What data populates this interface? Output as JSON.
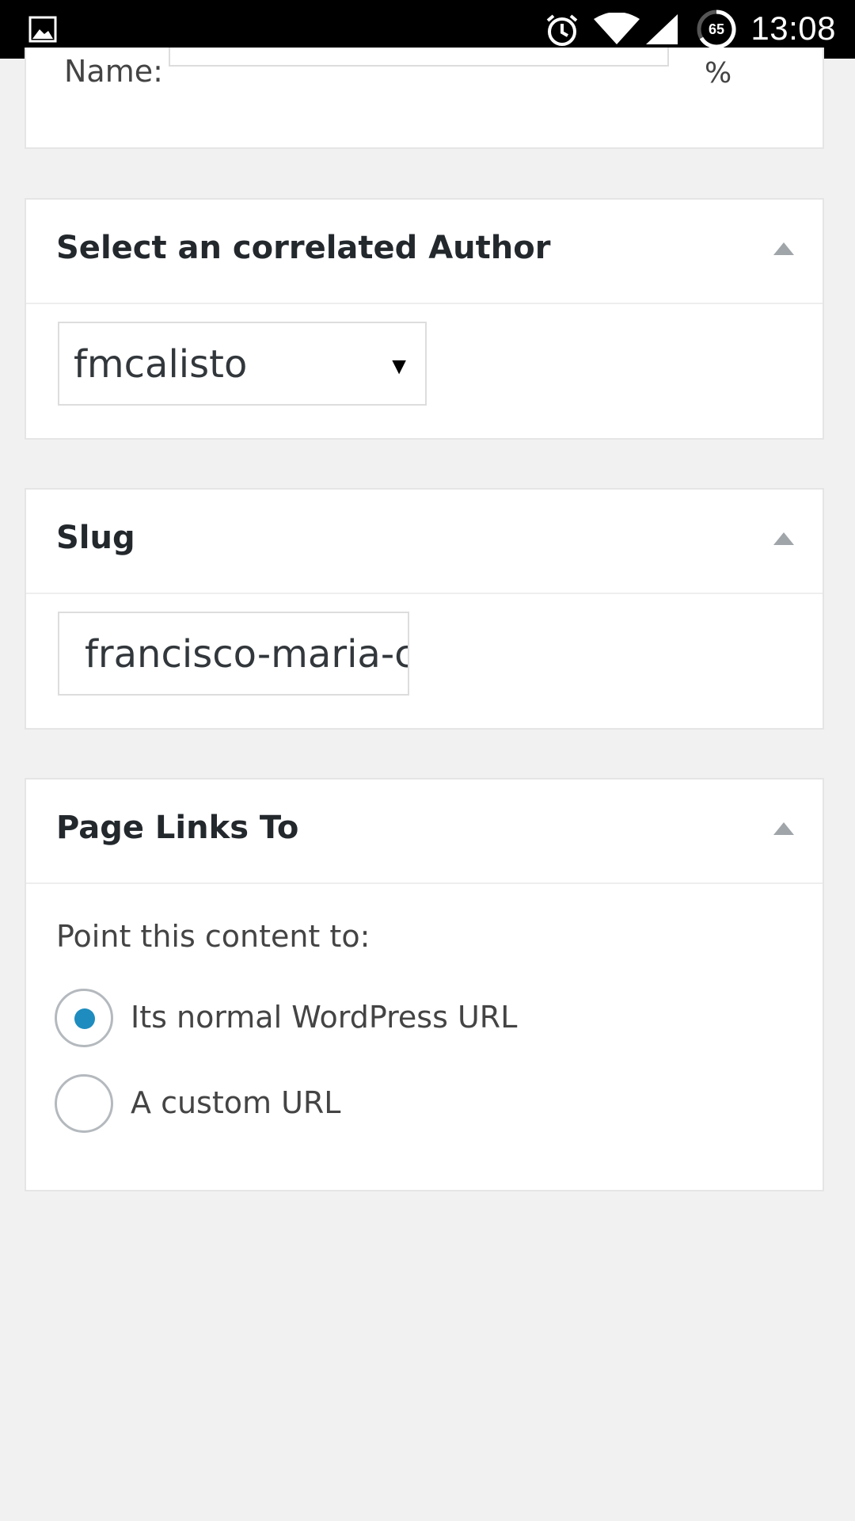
{
  "status_bar": {
    "time": "13:08",
    "battery_level": "65",
    "icons": [
      "image-icon",
      "alarm-icon",
      "wifi-icon",
      "signal-icon",
      "battery-icon"
    ]
  },
  "top_box": {
    "name_label": "Name:",
    "name_value": "",
    "percent_sign": "%"
  },
  "author_box": {
    "title": "Select an correlated Author",
    "selected_author": "fmcalisto",
    "arrow": "▼"
  },
  "slug_box": {
    "title": "Slug",
    "slug_value": "francisco-maria-calisto"
  },
  "page_links_box": {
    "title": "Page Links To",
    "prompt": "Point this content to:",
    "options": [
      {
        "label": "Its normal WordPress URL",
        "checked": true
      },
      {
        "label": "A custom URL",
        "checked": false
      }
    ]
  },
  "colors": {
    "accent": "#1e8cbe",
    "background": "#f1f1f1",
    "toggle": "#a0a5aa"
  }
}
